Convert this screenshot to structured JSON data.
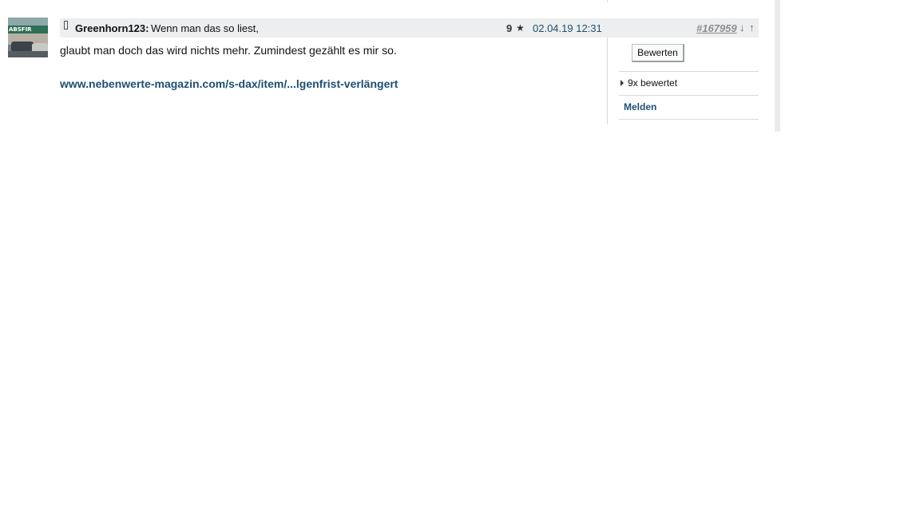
{
  "post": {
    "author": "Greenhorn123:",
    "subject": "Wenn man das so liest,",
    "rating_count": "9",
    "timestamp": "02.04.19 12:31",
    "number": "#167959",
    "arrow_down": "↓",
    "arrow_up": "↑",
    "body": "glaubt man doch das wird nichts mehr. Zumindest gezählt es mir so.",
    "link_text": "www.nebenwerte-magazin.com/s-dax/item/...lgenfrist-verlängert",
    "avatar_sign": "ABSFIR"
  },
  "side": {
    "rate_button": "Bewerten",
    "rated_label": "9x bewertet",
    "report_label": "Melden"
  },
  "icons": {
    "pin": "pin-icon",
    "star": "star-icon",
    "caret": "caret-right-icon"
  }
}
